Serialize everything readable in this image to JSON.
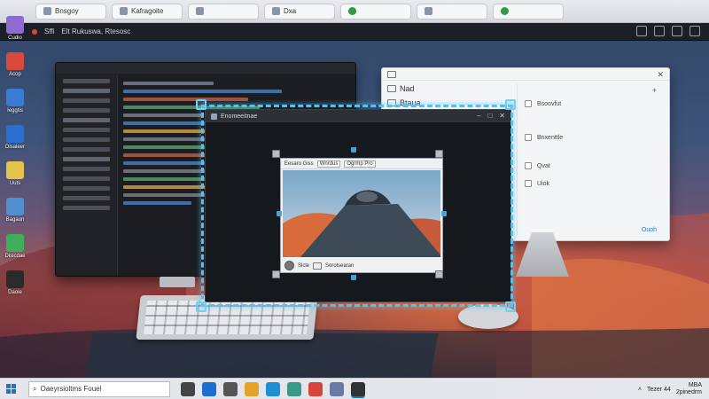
{
  "browser_tabs": [
    "Bnsgoy",
    "Kafragoite",
    "",
    "Dxa",
    "",
    "",
    ""
  ],
  "toolbar2": {
    "label": "Sffi",
    "title": "Elt Rukuswa, Rtesosc"
  },
  "desktop_icons": [
    {
      "label": "Cudio",
      "icon": "app-icon",
      "color": "#8e6bd0"
    },
    {
      "label": "Acop",
      "icon": "gift-icon",
      "color": "#d94a3c"
    },
    {
      "label": "Ieggtis",
      "icon": "monitor-icon",
      "color": "#3a7bd5"
    },
    {
      "label": "Disaleer",
      "icon": "cube-icon",
      "color": "#2d6fd0"
    },
    {
      "label": "Uuts",
      "icon": "folder-icon",
      "color": "#e6c34a"
    },
    {
      "label": "Bagaun",
      "icon": "globe-icon",
      "color": "#4f8fcf"
    },
    {
      "label": "Disicdae",
      "icon": "clip-icon",
      "color": "#3fae5a"
    },
    {
      "label": "Daoie",
      "icon": "pause-icon",
      "color": "#2a2a2a"
    }
  ],
  "settings_window": {
    "left_rows": [
      "Nad",
      "Btaua"
    ],
    "items": [
      "Bsoovfut",
      "Bnxenttle",
      "Qvat",
      "Uiok"
    ],
    "link": "Ouoh"
  },
  "main_window": {
    "title": "Enomeeitnae",
    "controls": [
      "–",
      "□",
      "✕"
    ]
  },
  "inner_viewer": {
    "title": "Eesaro Giss",
    "buttons": [
      "Wnrdus",
      "Ogrmp Pro"
    ],
    "footer": [
      "Sicle",
      "Sorolsearan"
    ]
  },
  "taskbar": {
    "search_placeholder": "Oaeyrsioltms Fouel",
    "tray_text": "Tezer 44",
    "clock_time": "MBA",
    "clock_date": "2pinedrm",
    "apps": [
      "#444",
      "#1c6fd1",
      "#555",
      "#e2a52a",
      "#1f8fd4",
      "#3a9a8a",
      "#d7453c",
      "#6a7aa5",
      "#333"
    ]
  }
}
